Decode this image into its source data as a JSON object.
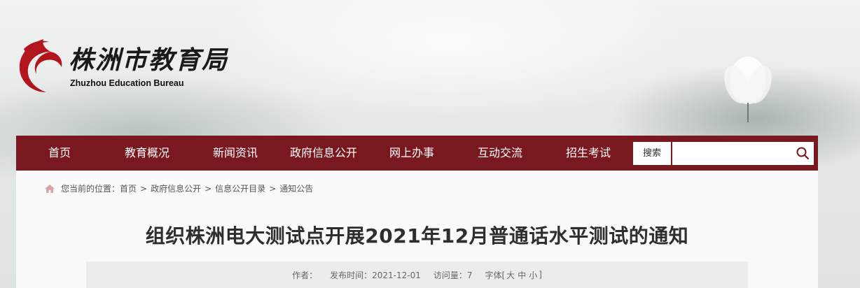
{
  "header": {
    "logo_cn": "株洲市教育局",
    "logo_en": "Zhuzhou Education Bureau"
  },
  "nav": {
    "items": [
      "首页",
      "教育概况",
      "新闻资讯",
      "政府信息公开",
      "网上办事",
      "互动交流",
      "招生考试"
    ],
    "search_label": "搜索",
    "search_value": ""
  },
  "breadcrumb": {
    "prefix": "您当前的位置：",
    "items": [
      "首页",
      "政府信息公开",
      "信息公开目录",
      "通知公告"
    ],
    "separator": ">"
  },
  "article": {
    "title": "组织株洲电大测试点开展2021年12月普通话水平测试的通知",
    "author_label": "作者：",
    "publish_label": "发布时间：2021-12-01",
    "views_label": "访问量：7",
    "fontsize_label": "字体[",
    "fontsize_large": "大",
    "fontsize_medium": "中",
    "fontsize_small": "小",
    "fontsize_end": "]"
  },
  "colors": {
    "nav_bg": "#7a1820",
    "logo_red": "#b3151f"
  }
}
